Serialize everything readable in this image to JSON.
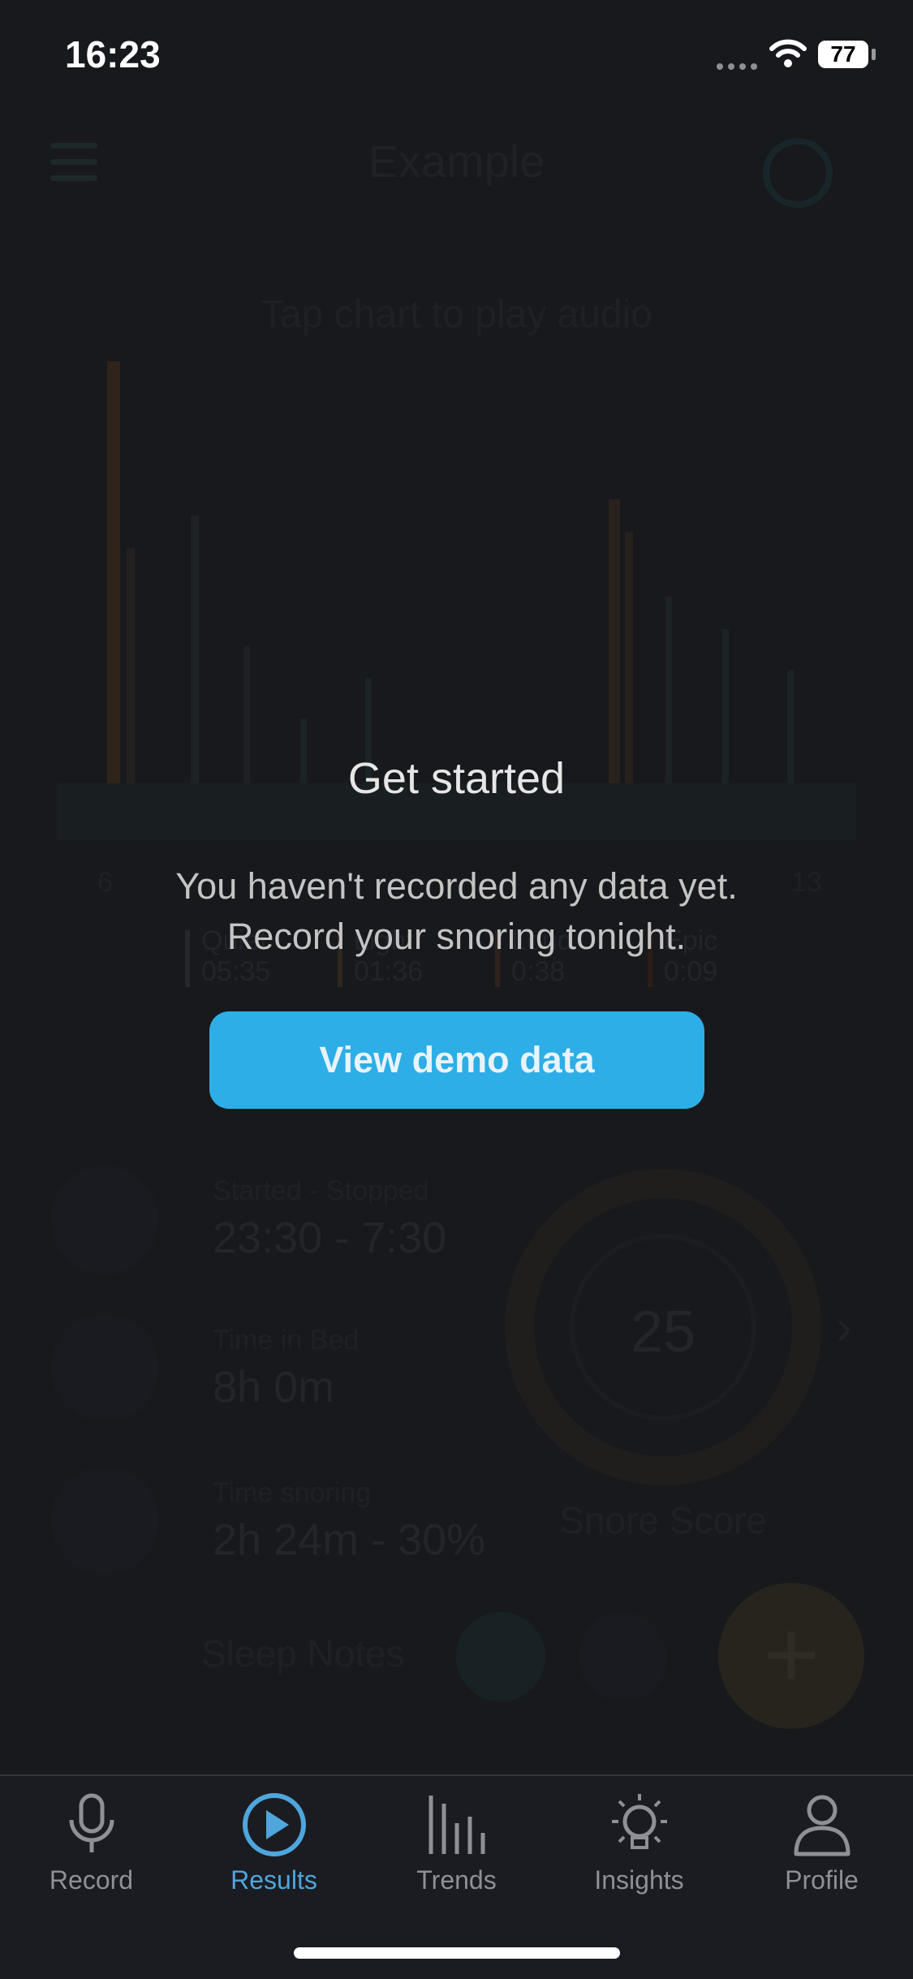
{
  "status_bar": {
    "time": "16:23",
    "battery": "77"
  },
  "background": {
    "header_title": "Example",
    "chart_hint": "Tap chart to play audio",
    "axis_start": "6",
    "axis_end": "13",
    "legend": [
      {
        "label": "Quiet",
        "value": "05:35",
        "color": "#3a3d42"
      },
      {
        "label": "Light",
        "value": "01:36",
        "color": "#c78c3a"
      },
      {
        "label": "Loud",
        "value": "0:38",
        "color": "#c56a2f"
      },
      {
        "label": "Epic",
        "value": "0:09",
        "color": "#b8431c"
      }
    ],
    "stats": [
      {
        "label": "Started - Stopped",
        "value": "23:30 - 7:30",
        "icon": "alarm-clock-icon"
      },
      {
        "label": "Time in Bed",
        "value": "8h 0m",
        "icon": "bed-icon"
      },
      {
        "label": "Time snoring",
        "value": "2h 24m - 30%",
        "icon": "heartbeat-icon"
      }
    ],
    "snore_score_value": "25",
    "snore_score_label": "Snore Score",
    "sleep_notes_label": "Sleep Notes"
  },
  "modal": {
    "title": "Get started",
    "message_line1": "You haven't recorded any data yet.",
    "message_line2": "Record your snoring tonight.",
    "button_label": "View demo data"
  },
  "tabs": [
    {
      "label": "Record",
      "icon": "microphone-icon",
      "active": false
    },
    {
      "label": "Results",
      "icon": "play-circle-icon",
      "active": true
    },
    {
      "label": "Trends",
      "icon": "bar-chart-icon",
      "active": false
    },
    {
      "label": "Insights",
      "icon": "lightbulb-icon",
      "active": false
    },
    {
      "label": "Profile",
      "icon": "person-icon",
      "active": false
    }
  ],
  "colors": {
    "accent": "#2daee6",
    "tab_active": "#4ea6dc",
    "tab_inactive": "#8e9096"
  }
}
